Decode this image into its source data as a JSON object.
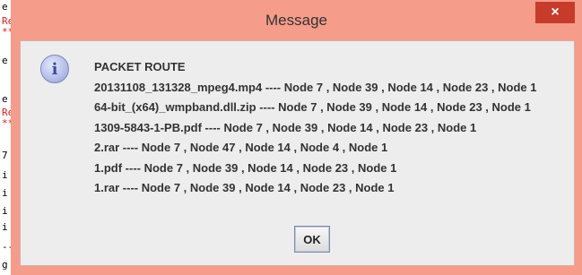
{
  "background_console": {
    "lines": [
      "e",
      "Rep",
      "***",
      "e S",
      "e S",
      "Rep",
      "***",
      "7",
      "i",
      "i",
      "i",
      "i",
      "--",
      "g"
    ]
  },
  "dialog": {
    "title": "Message",
    "close_glyph": "×",
    "icon": "info-icon",
    "heading": "PACKET ROUTE",
    "routes": [
      "20131108_131328_mpeg4.mp4  ----  Node 7 , Node 39 , Node 14 , Node 23 , Node 1",
      "64-bit_(x64)_wmpband.dll.zip  ----  Node 7 , Node 39 , Node 14 , Node 23 , Node 1",
      "1309-5843-1-PB.pdf  ----  Node 7 , Node 39 , Node 14 , Node 23 , Node 1",
      "2.rar  ----  Node 7 , Node 47 , Node 14 , Node 4 , Node 1",
      "1.pdf  ----  Node 7 , Node 39 , Node 14 , Node 23 , Node 1",
      "1.rar  ----  Node 7 , Node 39 , Node 14 , Node 23 , Node 1"
    ],
    "ok_label": "OK"
  },
  "colors": {
    "title_bar": "#f69c8a",
    "close_button": "#c73b2b",
    "content_bg": "#ededed"
  }
}
